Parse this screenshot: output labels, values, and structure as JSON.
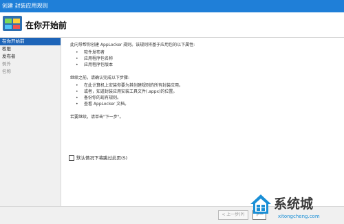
{
  "window": {
    "title": "创建 封装应用规则"
  },
  "header": {
    "heading": "在你开始前"
  },
  "sidebar": {
    "items": [
      {
        "label": "在你开始前"
      },
      {
        "label": "权限"
      },
      {
        "label": "发布者"
      },
      {
        "label": "例外"
      },
      {
        "label": "名称"
      }
    ]
  },
  "main": {
    "intro": "此向导帮你创建 AppLocker 规则。该规则将基于应用包的以下属性:",
    "properties": [
      "软件发布者",
      "应用程序包名称",
      "应用程序包版本"
    ],
    "prereq_intro": "继续之前，请确认完成以下步骤:",
    "steps": [
      "在此计算机上安装你要为其创建规则的所有封装应用。",
      "或者，知道封装应用安装工具文件(.appx)的位置。",
      "备份你的现有规则。",
      "查看 AppLocker 文档。"
    ],
    "continue_text": "若要继续，请单击\"下一步\"。",
    "skip_checkbox_label": "默认情况下将跳过此页(S)"
  },
  "footer": {
    "prev_label": "< 上一步(P)",
    "next_label": "下一"
  },
  "watermark": {
    "brand": "系统城",
    "url": "xitongcheng.com"
  },
  "colors": {
    "titlebar": "#1f7fd8",
    "selected": "#1d64b8",
    "watermark_url": "#1a8fd6"
  }
}
